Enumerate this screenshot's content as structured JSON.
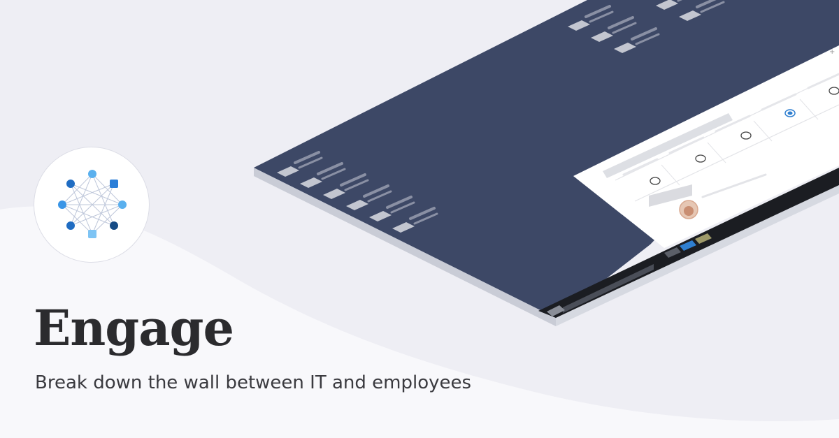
{
  "brand": {
    "headline": "Engage",
    "tagline": "Break down the wall between IT and employees",
    "logo_icon": "network-graph-icon"
  },
  "colors": {
    "background": "#eeeef4",
    "wave": "#f8f8fb",
    "desktop": "#3d4866",
    "desktop_edge": "#c9ccd6",
    "taskbar": "#1b1d22",
    "panel": "#ffffff",
    "accent": "#2f7fd0",
    "text_dark": "#2b2b2e"
  },
  "illustration": {
    "desktop_left_icons": 6,
    "desktop_top_icons": 5,
    "survey_options": 5,
    "survey_selected_index": 3,
    "taskbar_tray_icons": [
      "gray-app-icon",
      "blue-app-icon",
      "olive-app-icon"
    ]
  }
}
